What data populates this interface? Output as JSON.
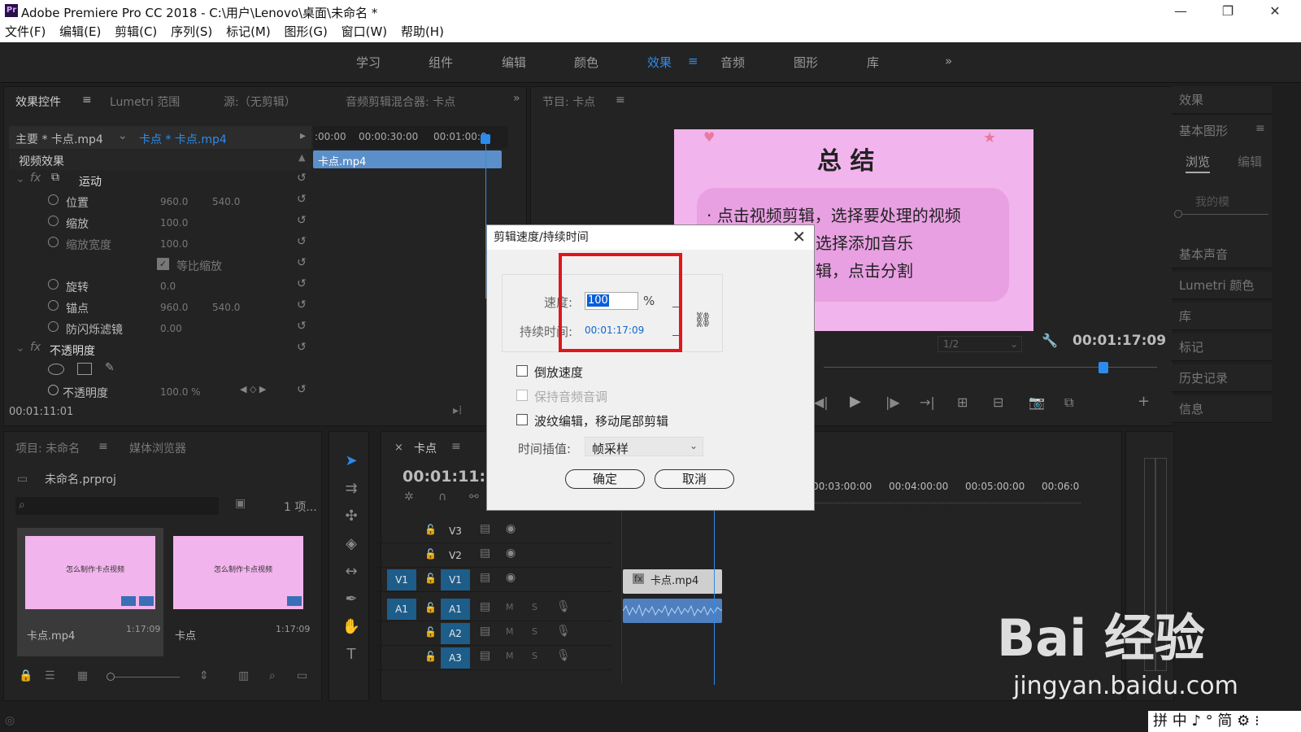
{
  "app": {
    "title": "Adobe Premiere Pro CC 2018 - C:\\用户\\Lenovo\\桌面\\未命名 *",
    "logo": "Pr"
  },
  "menu": [
    "文件(F)",
    "编辑(E)",
    "剪辑(C)",
    "序列(S)",
    "标记(M)",
    "图形(G)",
    "窗口(W)",
    "帮助(H)"
  ],
  "workspaces": [
    "学习",
    "组件",
    "编辑",
    "颜色",
    "效果",
    "音频",
    "图形",
    "库"
  ],
  "active_workspace": "效果",
  "effect_controls": {
    "tabs": [
      "效果控件",
      "Lumetri 范围",
      "源:（无剪辑）",
      "音频剪辑混合器: 卡点"
    ],
    "master": "主要 * 卡点.mp4",
    "sequence_clip": "卡点 * 卡点.mp4",
    "ruler": [
      ":00:00",
      "00:00:30:00",
      "00:01:00:0"
    ],
    "clip_label": "卡点.mp4",
    "section": "视频效果",
    "motion": "运动",
    "props": [
      {
        "name": "位置",
        "v1": "960.0",
        "v2": "540.0"
      },
      {
        "name": "缩放",
        "v1": "100.0",
        "v2": ""
      },
      {
        "name": "缩放宽度",
        "v1": "100.0",
        "v2": ""
      },
      {
        "name": "等比缩放",
        "v1": "",
        "v2": ""
      },
      {
        "name": "旋转",
        "v1": "0.0",
        "v2": ""
      },
      {
        "name": "锚点",
        "v1": "960.0",
        "v2": "540.0"
      },
      {
        "name": "防闪烁滤镜",
        "v1": "0.00",
        "v2": ""
      }
    ],
    "opacity": "不透明度",
    "opacity_prop": {
      "name": "不透明度",
      "v1": "100.0 %"
    },
    "timecode": "00:01:11:01"
  },
  "program": {
    "tab": "节目: 卡点",
    "slide_title": "总  结",
    "slide_lines": [
      "· 点击视频剪辑，选择要处理的视频",
      "选择添加音乐",
      "辑，点击分割"
    ],
    "zoom": "1/2",
    "timecode": "00:01:17:09"
  },
  "right_panels": [
    "效果",
    "基本图形",
    "基本声音",
    "Lumetri 颜色",
    "库",
    "标记",
    "历史记录",
    "信息"
  ],
  "essential_graphics": {
    "tabs": [
      "浏览",
      "编辑"
    ],
    "search": "我的模"
  },
  "project": {
    "tabs": [
      "项目: 未命名",
      "媒体浏览器"
    ],
    "file": "未命名.prproj",
    "count": "1 项...",
    "items": [
      {
        "name": "卡点.mp4",
        "dur": "1:17:09",
        "thumb": "怎么制作卡点视频"
      },
      {
        "name": "卡点",
        "dur": "1:17:09",
        "thumb": "怎么制作卡点视频"
      }
    ]
  },
  "timeline": {
    "tab": "卡点",
    "timecode": "00:01:11:0",
    "ruler": [
      "00:03:00:00",
      "00:04:00:00",
      "00:05:00:00",
      "00:06:0"
    ],
    "tracks": [
      "V3",
      "V2",
      "V1",
      "A1",
      "A2",
      "A3"
    ],
    "clip": "卡点.mp4"
  },
  "dialog": {
    "title": "剪辑速度/持续时间",
    "speed_label": "速度:",
    "speed_value": "100",
    "percent": "%",
    "duration_label": "持续时间:",
    "duration_value": "00:01:17:09",
    "reverse": "倒放速度",
    "keep_pitch": "保持音频音调",
    "ripple": "波纹编辑，移动尾部剪辑",
    "interp_label": "时间插值:",
    "interp_value": "帧采样",
    "ok": "确定",
    "cancel": "取消"
  },
  "watermark": {
    "brand": "Bai 经验",
    "url": "jingyan.baidu.com"
  },
  "ime": "拼 中 ♪ ° 简 ⚙ ⁝",
  "colors": {
    "accent": "#2d8ceb",
    "highlight_box": "#e0161c",
    "slide_bg": "#f2b4ec"
  }
}
